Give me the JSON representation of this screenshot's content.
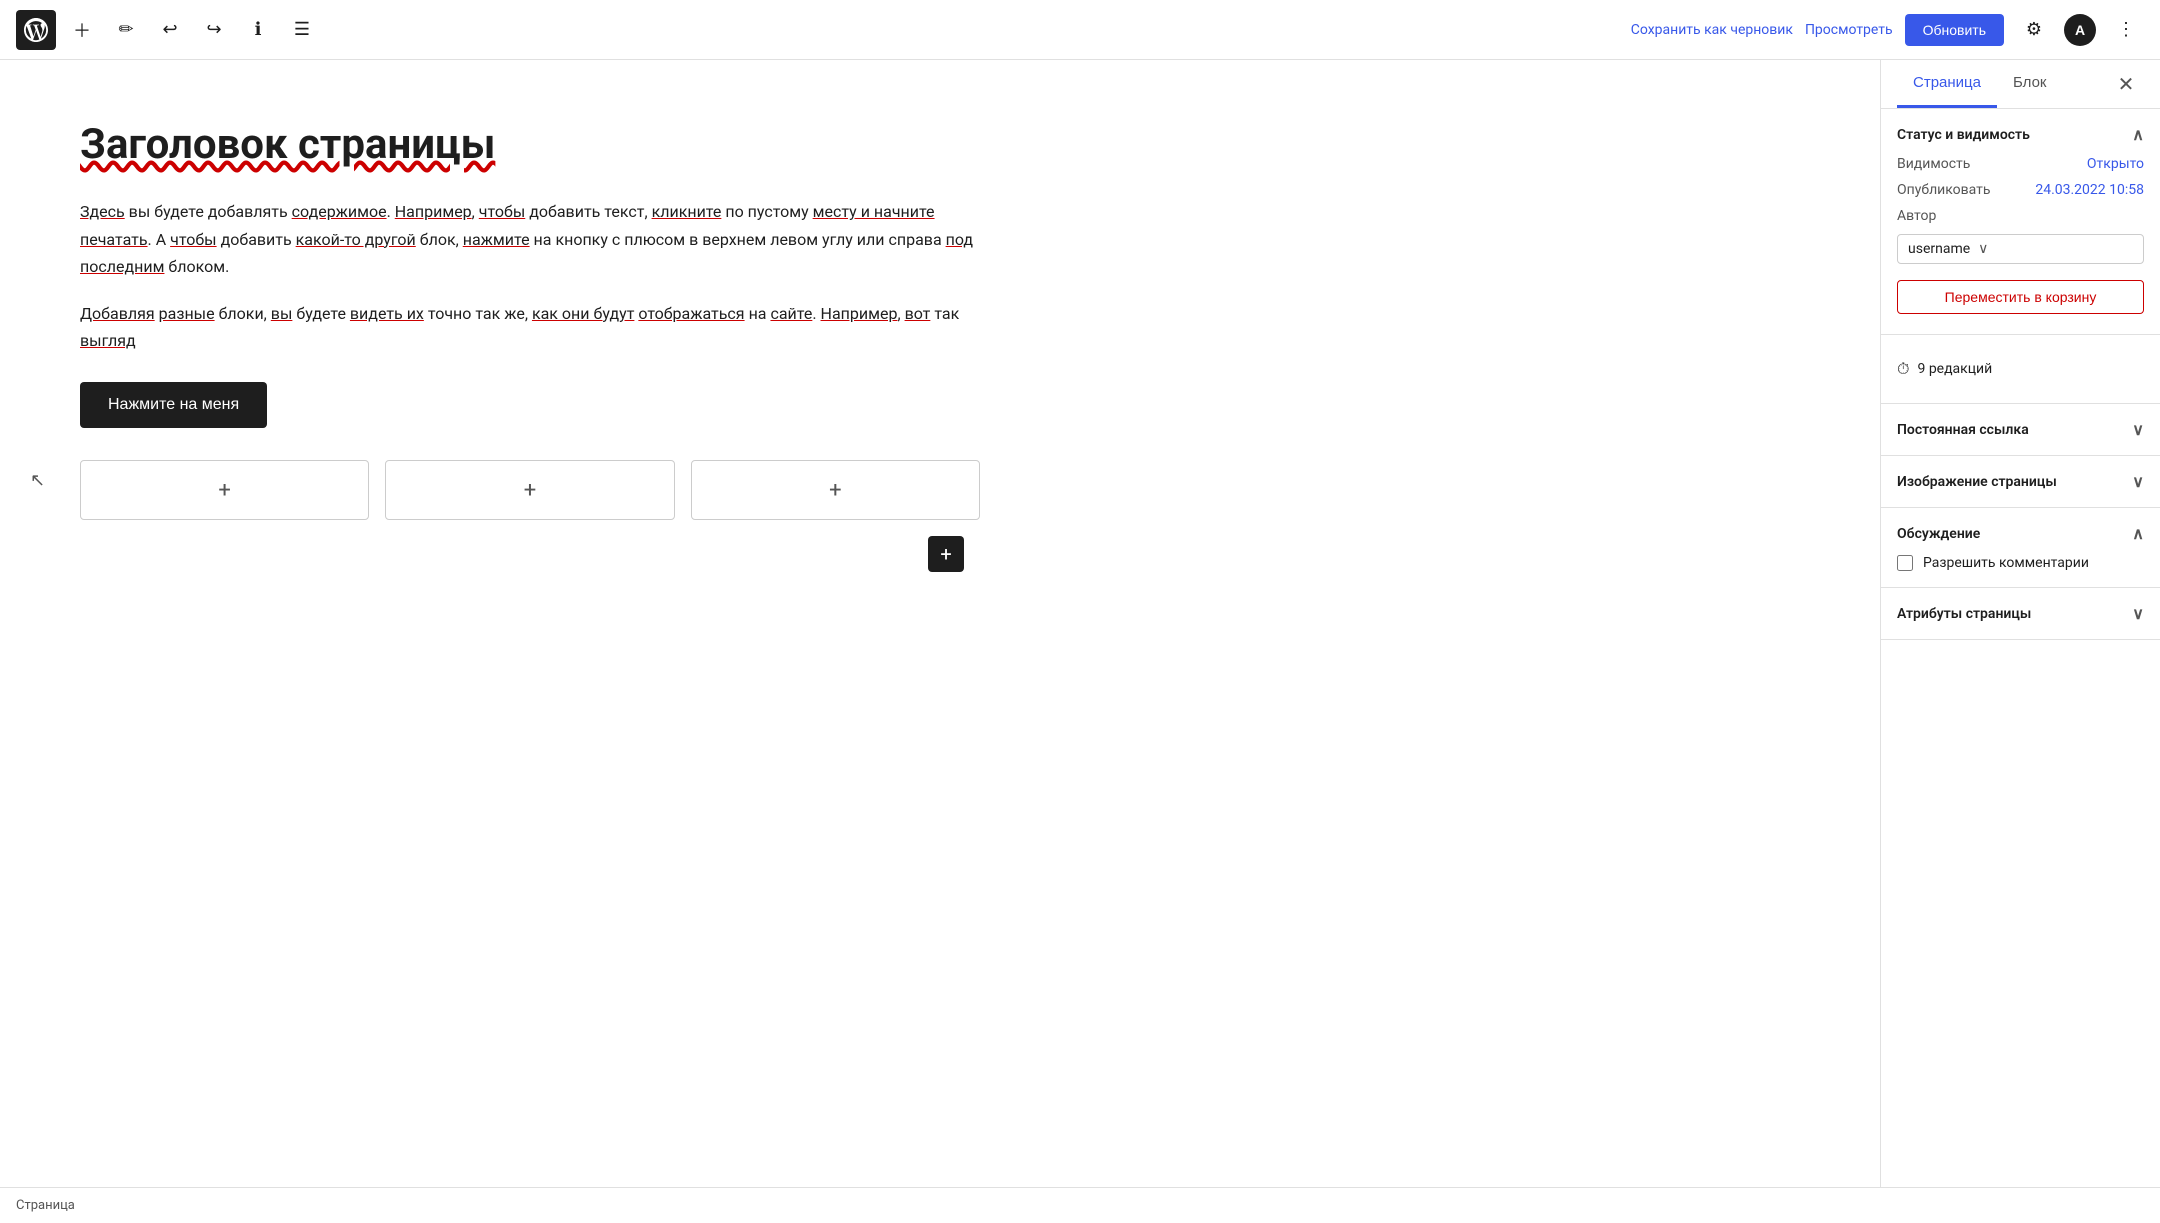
{
  "topbar": {
    "save_draft_label": "Сохранить как черновик",
    "preview_label": "Просмотреть",
    "update_label": "Обновить"
  },
  "editor": {
    "page_title": "Заголовок страницы",
    "paragraph1": "Здесь вы будете добавлять содержимое. Например, чтобы добавить текст, кликните по пустому месту и начните печатать. А чтобы добавить какой-то другой блок, нажмите на кнопку с плюсом в верхнем левом углу или справа под последним блоком.",
    "paragraph2": "Добавляя разные блоки, вы будете видеть их точно так же, как они будут отображаться на сайте. Например, вот так выгляд",
    "button_label": "Нажмите на меня"
  },
  "status_bar": {
    "label": "Страница"
  },
  "sidebar": {
    "tab_page": "Страница",
    "tab_block": "Блок",
    "section_status": "Статус и видимость",
    "label_visibility": "Видимость",
    "value_visibility": "Открыто",
    "label_publish": "Опубликовать",
    "value_publish": "24.03.2022 10:58",
    "label_author": "Автор",
    "author_name": "username",
    "btn_trash": "Переместить в корзину",
    "revisions_label": "9 редакций",
    "section_permalink": "Постоянная ссылка",
    "section_page_image": "Изображение страницы",
    "section_discussion": "Обсуждение",
    "label_allow_comments": "Разрешить комментарии",
    "section_page_attrs": "Атрибуты страницы"
  }
}
